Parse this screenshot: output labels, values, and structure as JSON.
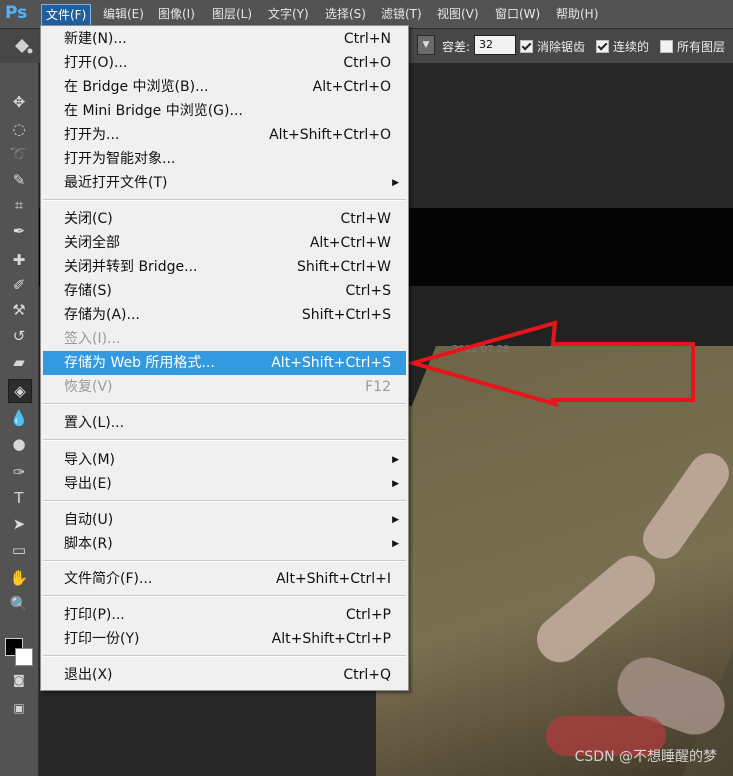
{
  "app": {
    "logo": "Ps"
  },
  "menubar": [
    {
      "label": "文件(F)",
      "active": true
    },
    {
      "label": "编辑(E)"
    },
    {
      "label": "图像(I)"
    },
    {
      "label": "图层(L)"
    },
    {
      "label": "文字(Y)"
    },
    {
      "label": "选择(S)"
    },
    {
      "label": "滤镜(T)"
    },
    {
      "label": "视图(V)"
    },
    {
      "label": "窗口(W)"
    },
    {
      "label": "帮助(H)"
    }
  ],
  "options": {
    "tolerance_label": "容差:",
    "tolerance_value": "32",
    "antialias_label": "消除锯齿",
    "contiguous_label": "连续的",
    "all_layers_label": "所有图层",
    "antialias_checked": true,
    "contiguous_checked": true,
    "all_layers_checked": false
  },
  "file_menu": {
    "items": [
      {
        "label": "新建(N)...",
        "shortcut": "Ctrl+N"
      },
      {
        "label": "打开(O)...",
        "shortcut": "Ctrl+O"
      },
      {
        "label": "在 Bridge 中浏览(B)...",
        "shortcut": "Alt+Ctrl+O"
      },
      {
        "label": "在 Mini Bridge 中浏览(G)...",
        "shortcut": ""
      },
      {
        "label": "打开为...",
        "shortcut": "Alt+Shift+Ctrl+O"
      },
      {
        "label": "打开为智能对象...",
        "shortcut": ""
      },
      {
        "label": "最近打开文件(T)",
        "shortcut": "",
        "submenu": true
      },
      {
        "label": "关闭(C)",
        "shortcut": "Ctrl+W"
      },
      {
        "label": "关闭全部",
        "shortcut": "Alt+Ctrl+W"
      },
      {
        "label": "关闭并转到 Bridge...",
        "shortcut": "Shift+Ctrl+W"
      },
      {
        "label": "存储(S)",
        "shortcut": "Ctrl+S"
      },
      {
        "label": "存储为(A)...",
        "shortcut": "Shift+Ctrl+S"
      },
      {
        "label": "签入(I)...",
        "shortcut": "",
        "disabled": true
      },
      {
        "label": "存储为 Web 所用格式...",
        "shortcut": "Alt+Shift+Ctrl+S",
        "highlighted": true
      },
      {
        "label": "恢复(V)",
        "shortcut": "F12",
        "disabled": true
      },
      {
        "label": "置入(L)...",
        "shortcut": ""
      },
      {
        "label": "导入(M)",
        "shortcut": "",
        "submenu": true
      },
      {
        "label": "导出(E)",
        "shortcut": "",
        "submenu": true
      },
      {
        "label": "自动(U)",
        "shortcut": "",
        "submenu": true
      },
      {
        "label": "脚本(R)",
        "shortcut": "",
        "submenu": true
      },
      {
        "label": "文件简介(F)...",
        "shortcut": "Alt+Shift+Ctrl+I"
      },
      {
        "label": "打印(P)...",
        "shortcut": "Ctrl+P"
      },
      {
        "label": "打印一份(Y)",
        "shortcut": "Alt+Shift+Ctrl+P"
      },
      {
        "label": "退出(X)",
        "shortcut": "Ctrl+Q"
      }
    ],
    "submenu_arrow": "▶"
  },
  "canvas": {
    "stamp_text": "2021 07 28",
    "watermark": "CSDN @不想睡醒的梦"
  },
  "colors": {
    "highlight": "#3399e0",
    "annotation_arrow": "#e8141b"
  }
}
